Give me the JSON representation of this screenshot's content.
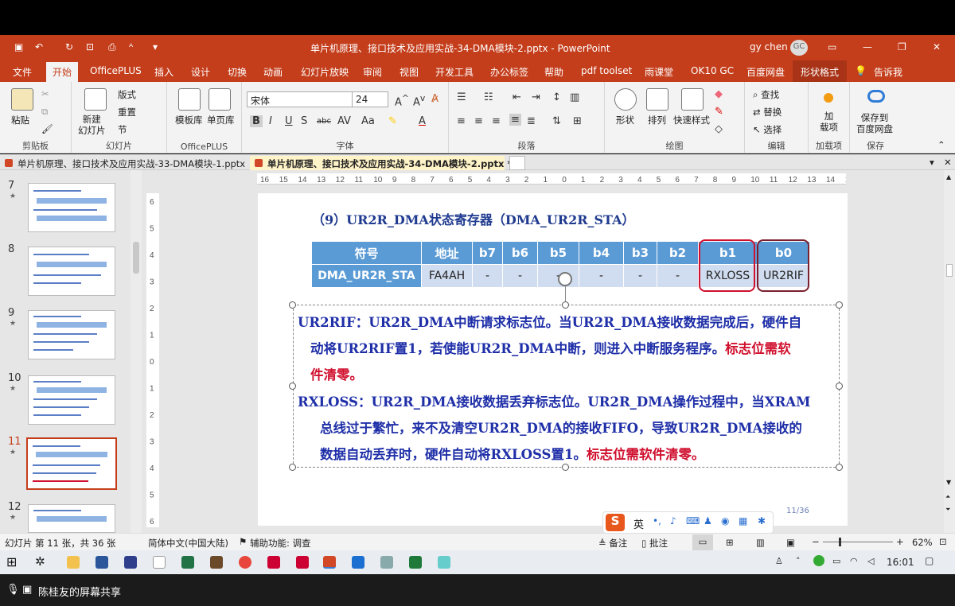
{
  "window": {
    "title": "单片机原理、接口技术及应用实战-34-DMA模块-2.pptx  -  PowerPoint",
    "user": "gy chen",
    "user_initials": "GC"
  },
  "ribbon_tabs": [
    "文件",
    "开始",
    "OfficePLUS",
    "插入",
    "设计",
    "切换",
    "动画",
    "幻灯片放映",
    "审阅",
    "视图",
    "开发工具",
    "办公标签",
    "帮助",
    "pdf toolset",
    "雨课堂",
    "OK10 GC",
    "百度网盘",
    "形状格式",
    "告诉我"
  ],
  "groups": {
    "clipboard": "剪贴板",
    "slides": "幻灯片",
    "officeplus": "OfficePLUS",
    "font": "字体",
    "paragraph": "段落",
    "drawing": "绘图",
    "edit": "编辑",
    "addins": "加载项",
    "save": "保存"
  },
  "buttons": {
    "paste": "粘贴",
    "new_slide": "新建\n幻灯片",
    "layout": "版式",
    "reset": "重置",
    "section": "节",
    "template": "模板库",
    "single_page": "单页库",
    "shape": "形状",
    "arrange": "排列",
    "quick_style": "快速样式",
    "find": "查找",
    "replace": "替换",
    "select": "选择",
    "addin": "加\n载项",
    "save_baidu": "保存到\n百度网盘"
  },
  "font": {
    "name": "宋体",
    "size": "24"
  },
  "doc_tabs": [
    "单片机原理、接口技术及应用实战-33-DMA模块-1.pptx",
    "单片机原理、接口技术及应用实战-34-DMA模块-2.pptx *"
  ],
  "thumbnails": [
    {
      "num": "7"
    },
    {
      "num": "8"
    },
    {
      "num": "9"
    },
    {
      "num": "10"
    },
    {
      "num": "11"
    },
    {
      "num": "12"
    }
  ],
  "slide": {
    "title": "（9）UR2R_DMA状态寄存器（DMA_UR2R_STA）",
    "header_row": [
      "符号",
      "地址",
      "b7",
      "b6",
      "b5",
      "b4",
      "b3",
      "b2",
      "b1",
      "b0"
    ],
    "data_row": [
      "DMA_UR2R_STA",
      "FA4AH",
      "-",
      "-",
      "-",
      "-",
      "-",
      "-",
      "RXLOSS",
      "UR2RIF"
    ],
    "p1_line1": "UR2RIF：UR2R_DMA中断请求标志位。当UR2R_DMA接收数据完成后，硬件自",
    "p1_line2a": "动将UR2RIF置1，若使能UR2R_DMA中断，则进入中断服务程序。",
    "p1_line2b": "标志位需软",
    "p1_line3": "件清零。",
    "p2_line1": "RXLOSS：UR2R_DMA接收数据丢弃标志位。UR2R_DMA操作过程中，当XRAM",
    "p2_line2": "总线过于繁忙，来不及清空UR2R_DMA的接收FIFO，导致UR2R_DMA接收的",
    "p2_line3a": "数据自动丢弃时，硬件自动将RXLOSS置1。",
    "p2_line3b": "标志位需软件清零。",
    "page": "11/36"
  },
  "status": {
    "slide_info": "幻灯片 第 11 张，共 36 张",
    "lang": "简体中文(中国大陆)",
    "access": "辅助功能: 调查",
    "notes": "备注",
    "comments": "批注",
    "zoom": "62%"
  },
  "ime": {
    "lang": "英"
  },
  "taskbar": {
    "time": "16:01"
  },
  "share": {
    "text": "陈桂友的屏幕共享"
  },
  "colors": {
    "accent": "#c43e1c",
    "table_header": "#5b9bd5",
    "text_blue": "#1f2fa8",
    "text_red": "#d0102e"
  }
}
